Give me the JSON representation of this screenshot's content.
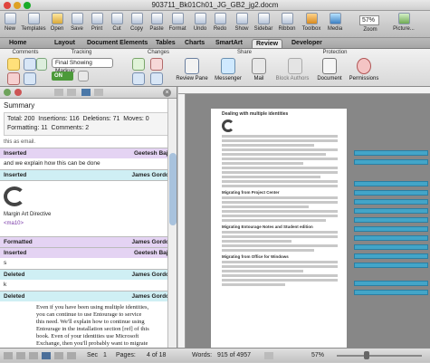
{
  "window": {
    "title": "903711_Bk01Ch01_JG_GB2_jg2.docm",
    "zoom": "57%"
  },
  "toolbar": {
    "items": [
      "New",
      "Templates",
      "Open",
      "Save",
      "Print",
      "Cut",
      "Copy",
      "Paste",
      "Format",
      "Undo",
      "Redo",
      "Show",
      "Sidebar",
      "Ribbon",
      "Toolbox",
      "Media",
      "Zoom",
      "Picture..."
    ],
    "zoom_value": "57%"
  },
  "ribbon_tabs": [
    "Home",
    "Layout",
    "Document Elements",
    "Tables",
    "Charts",
    "SmartArt",
    "Review",
    "Developer"
  ],
  "ribbon_active": "Review",
  "groups": {
    "comments": "Comments",
    "tracking": "Tracking",
    "changes": "Changes",
    "share": "Share",
    "protection": "Protection"
  },
  "tracking": {
    "markup_select": "Final Showing Markup",
    "switch_label": "ON"
  },
  "share_buttons": [
    "Review Pane",
    "Messenger",
    "Mail",
    "Block Authors",
    "Document",
    "Permissions"
  ],
  "review_pane": {
    "summary_title": "Summary",
    "stats": {
      "total": "Total: 200",
      "insertions": "Insertions: 116",
      "deletions": "Deletions: 71",
      "moves": "Moves: 0",
      "formatting": "Formatting: 11",
      "comments": "Comments: 2"
    },
    "top_text": "this as email.",
    "revisions": [
      {
        "type": "Inserted",
        "author": "Geetesh Bajaj",
        "body": "and we explain how this can be done",
        "cls": "ins"
      },
      {
        "type": "Inserted",
        "author": "James Gordon",
        "body": "",
        "cls": "del"
      },
      {
        "type": "",
        "author": "",
        "body": "Margin Art Directive",
        "cls": "img"
      },
      {
        "type": "Formatted",
        "author": "James Gordon",
        "body": "<ma10>",
        "cls": "fmt"
      },
      {
        "type": "Inserted",
        "author": "Geetesh Bajaj",
        "body": "s",
        "cls": "ins"
      },
      {
        "type": "Deleted",
        "author": "James Gordon",
        "body": "k",
        "cls": "del"
      },
      {
        "type": "Deleted",
        "author": "James Gordon",
        "body": "Even if you have been using multiple identities, you can continue to use Entourage to service this need. We'll explain how to continue using Entourage in the installation section [ref] of this book. Even of your identities use Microsoft Exchange, then you'll probably want to migrate that one to Outlook and keep Entourage installed for the others.",
        "cls": "del"
      }
    ]
  },
  "document": {
    "heading": "Dealing with multiple identities",
    "sections": [
      "Migrating from Project Center",
      "Migrating Entourage Notes and Student edition",
      "Migrating from Office for Windows"
    ]
  },
  "status": {
    "sec": "Sec",
    "sec_value": "1",
    "pages_label": "Pages:",
    "pages_value": "4 of 18",
    "words_label": "Words:",
    "words_value": "915 of 4957",
    "zoom": "57%"
  }
}
